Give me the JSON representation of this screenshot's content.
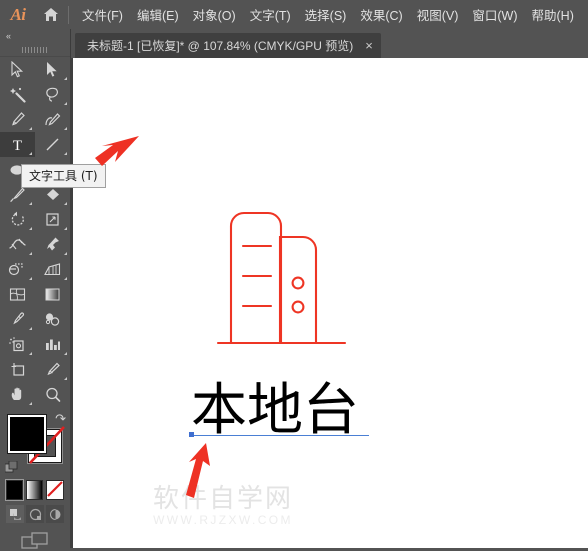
{
  "app": {
    "name": "Ai",
    "logo_color": "#e8935a",
    "home_icon": "home-icon"
  },
  "menubar": {
    "items": [
      {
        "label": "文件(F)",
        "name": "menu-file"
      },
      {
        "label": "编辑(E)",
        "name": "menu-edit"
      },
      {
        "label": "对象(O)",
        "name": "menu-object"
      },
      {
        "label": "文字(T)",
        "name": "menu-type"
      },
      {
        "label": "选择(S)",
        "name": "menu-select"
      },
      {
        "label": "效果(C)",
        "name": "menu-effect"
      },
      {
        "label": "视图(V)",
        "name": "menu-view"
      },
      {
        "label": "窗口(W)",
        "name": "menu-window"
      },
      {
        "label": "帮助(H)",
        "name": "menu-help"
      }
    ]
  },
  "document_tab": {
    "title": "未标题-1 [已恢复]* @ 107.84% (CMYK/GPU 预览)",
    "close_label": "×",
    "zoom_level": "107.84%",
    "color_mode": "CMYK/GPU 预览",
    "file_name": "未标题-1",
    "state": "[已恢复]",
    "modified": true
  },
  "toolbar": {
    "collapse_label": "«",
    "tools": [
      {
        "name": "selection-tool",
        "icon": "arrow-cursor-icon",
        "active": false,
        "has_flyout": false
      },
      {
        "name": "direct-selection-tool",
        "icon": "white-arrow-icon",
        "active": false,
        "has_flyout": true
      },
      {
        "name": "magic-wand-tool",
        "icon": "magic-wand-icon",
        "active": false,
        "has_flyout": false
      },
      {
        "name": "lasso-tool",
        "icon": "lasso-icon",
        "active": false,
        "has_flyout": false
      },
      {
        "name": "pen-tool",
        "icon": "pen-nib-icon",
        "active": false,
        "has_flyout": true
      },
      {
        "name": "curvature-tool",
        "icon": "curvature-icon",
        "active": false,
        "has_flyout": false
      },
      {
        "name": "type-tool",
        "icon": "type-T-icon",
        "active": true,
        "has_flyout": true
      },
      {
        "name": "line-segment-tool",
        "icon": "line-icon",
        "active": false,
        "has_flyout": true
      },
      {
        "name": "ellipse-tool",
        "icon": "ellipse-icon",
        "active": false,
        "has_flyout": true
      },
      {
        "name": "rectangle-tool",
        "icon": "rectangle-icon",
        "active": false,
        "has_flyout": true
      },
      {
        "name": "paintbrush-tool",
        "icon": "paintbrush-icon",
        "active": false,
        "has_flyout": true
      },
      {
        "name": "shaper-tool",
        "icon": "shaper-diamond-icon",
        "active": false,
        "has_flyout": true
      },
      {
        "name": "rotate-tool",
        "icon": "rotate-icon",
        "active": false,
        "has_flyout": true
      },
      {
        "name": "scale-tool",
        "icon": "scale-icon",
        "active": false,
        "has_flyout": true
      },
      {
        "name": "width-tool",
        "icon": "width-icon",
        "active": false,
        "has_flyout": true
      },
      {
        "name": "free-transform-tool",
        "icon": "pushpin-icon",
        "active": false,
        "has_flyout": true
      },
      {
        "name": "shape-builder-tool",
        "icon": "shape-builder-icon",
        "active": false,
        "has_flyout": true
      },
      {
        "name": "perspective-grid-tool",
        "icon": "perspective-grid-icon",
        "active": false,
        "has_flyout": true
      },
      {
        "name": "mesh-tool",
        "icon": "mesh-icon",
        "active": false,
        "has_flyout": false
      },
      {
        "name": "gradient-tool",
        "icon": "gradient-icon",
        "active": false,
        "has_flyout": false
      },
      {
        "name": "eyedropper-tool",
        "icon": "eyedropper-icon",
        "active": false,
        "has_flyout": true
      },
      {
        "name": "blend-tool",
        "icon": "blend-icon",
        "active": false,
        "has_flyout": false
      },
      {
        "name": "symbol-sprayer-tool",
        "icon": "symbol-sprayer-icon",
        "active": false,
        "has_flyout": true
      },
      {
        "name": "column-graph-tool",
        "icon": "bar-graph-icon",
        "active": false,
        "has_flyout": true
      },
      {
        "name": "artboard-tool",
        "icon": "artboard-icon",
        "active": false,
        "has_flyout": false
      },
      {
        "name": "slice-tool",
        "icon": "slice-knife-icon",
        "active": false,
        "has_flyout": true
      },
      {
        "name": "hand-tool",
        "icon": "hand-icon",
        "active": false,
        "has_flyout": true
      },
      {
        "name": "zoom-tool",
        "icon": "magnifier-icon",
        "active": false,
        "has_flyout": false
      }
    ],
    "colors": {
      "fill": "#000000",
      "stroke": "none",
      "fill_label": "fill-swatch",
      "stroke_label": "stroke-swatch",
      "swap_icon": "swap-arrow-icon",
      "default_icon": "default-colors-icon"
    },
    "fill_modes": [
      {
        "name": "color-mode-button",
        "icon": "solid-color-icon",
        "selected": true
      },
      {
        "name": "gradient-mode-button",
        "icon": "gradient-icon",
        "selected": false
      },
      {
        "name": "none-mode-button",
        "icon": "none-slash-icon",
        "selected": false
      }
    ],
    "draw_modes": [
      {
        "name": "draw-normal-button",
        "icon": "draw-normal-icon",
        "selected": true
      },
      {
        "name": "draw-behind-button",
        "icon": "draw-behind-icon",
        "selected": false
      },
      {
        "name": "draw-inside-button",
        "icon": "draw-inside-icon",
        "selected": false
      }
    ],
    "screen_mode": {
      "name": "change-screen-mode-button",
      "icon": "screen-mode-icon"
    }
  },
  "tooltip": {
    "text": "文字工具 (T)",
    "target": "type-tool"
  },
  "canvas": {
    "background": "#ffffff",
    "artwork": {
      "name": "desktop-computer-illustration",
      "stroke_color": "#ee3524",
      "description": "红色线稿台式电脑主机"
    },
    "text_object": {
      "content": "本地台",
      "color": "#000000",
      "baseline_color": "#4a7fd4",
      "anchor_color": "#3f6fd0"
    }
  },
  "annotations": [
    {
      "name": "arrow-to-type-tool",
      "color": "#ee3124",
      "direction": "down-left"
    },
    {
      "name": "arrow-to-text-object",
      "color": "#ee3124",
      "direction": "up"
    }
  ],
  "watermark": {
    "title": "软件自学网",
    "url": "WWW.RJZXW.COM"
  }
}
